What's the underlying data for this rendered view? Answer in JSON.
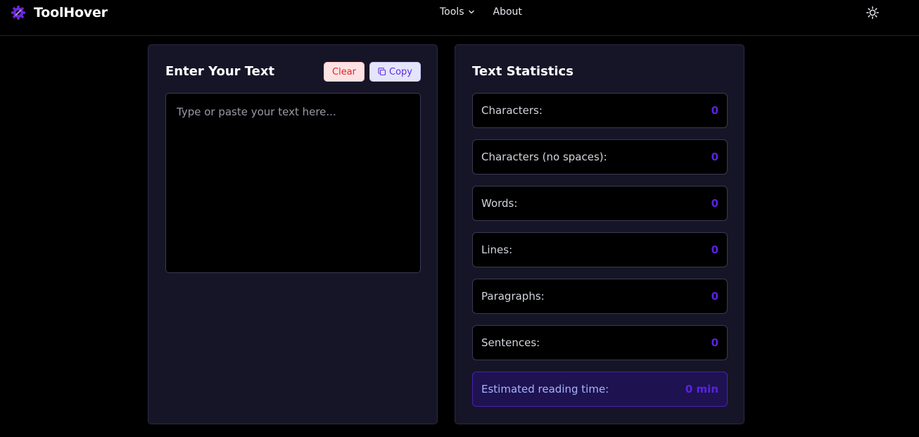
{
  "brand": {
    "name": "ToolHover",
    "logo_icon": "gear-wrench-icon"
  },
  "nav": {
    "tools_label": "Tools",
    "about_label": "About"
  },
  "theme_toggle": {
    "icon": "sun-icon"
  },
  "input_card": {
    "title": "Enter Your Text",
    "clear_label": "Clear",
    "copy_label": "Copy",
    "placeholder": "Type or paste your text here...",
    "value": ""
  },
  "stats_card": {
    "title": "Text Statistics",
    "items": [
      {
        "label": "Characters:",
        "value": "0"
      },
      {
        "label": "Characters (no spaces):",
        "value": "0"
      },
      {
        "label": "Words:",
        "value": "0"
      },
      {
        "label": "Lines:",
        "value": "0"
      },
      {
        "label": "Paragraphs:",
        "value": "0"
      },
      {
        "label": "Sentences:",
        "value": "0"
      }
    ],
    "reading_time": {
      "label": "Estimated reading time:",
      "value": "0 min"
    }
  },
  "colors": {
    "accent": "#5b21e6",
    "card_bg": "#161527",
    "page_bg": "#000000",
    "clear_text": "#dc2626",
    "copy_text": "#5b2ee0"
  }
}
